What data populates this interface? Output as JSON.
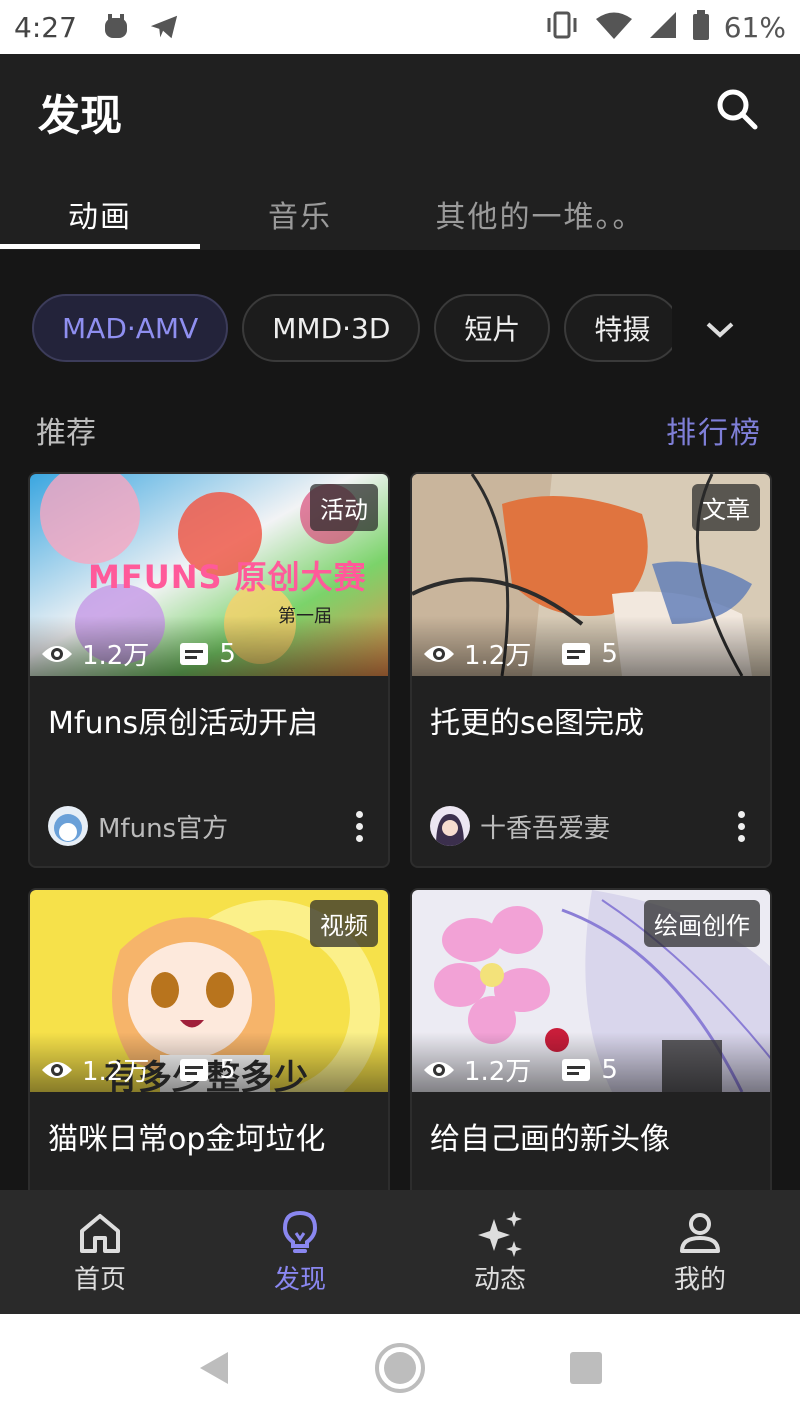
{
  "status_bar": {
    "time": "4:27",
    "battery": "61%",
    "left_icons": [
      "notification-app-icon",
      "telegram-icon"
    ],
    "right_icons": [
      "vibrate-icon",
      "wifi-icon",
      "signal-icon",
      "battery-icon"
    ]
  },
  "header": {
    "title": "发现",
    "search_icon": "search-icon"
  },
  "tabs": [
    {
      "label": "动画",
      "active": true
    },
    {
      "label": "音乐",
      "active": false
    },
    {
      "label": "其他的一堆。。",
      "active": false
    }
  ],
  "chips": [
    {
      "label": "MAD·AMV",
      "selected": true
    },
    {
      "label": "MMD·3D",
      "selected": false
    },
    {
      "label": "短片",
      "selected": false
    },
    {
      "label": "特摄",
      "selected": false
    }
  ],
  "section": {
    "title": "推荐",
    "rank_link": "排行榜"
  },
  "cards": [
    {
      "badge": "活动",
      "views": "1.2万",
      "comments": "5",
      "title": "Mfuns原创活动开启",
      "author": "Mfuns官方",
      "overlay_text": "MFUNS 原创大赛",
      "overlay_sub": "第一届"
    },
    {
      "badge": "文章",
      "views": "1.2万",
      "comments": "5",
      "title": "托更的se图完成",
      "author": "十香吾爱妻"
    },
    {
      "badge": "视频",
      "views": "1.2万",
      "comments": "5",
      "title": "猫咪日常op金坷垃化",
      "author": "",
      "overlay_text": "有多少整多少"
    },
    {
      "badge": "绘画创作",
      "views": "1.2万",
      "comments": "5",
      "title": "给自己画的新头像",
      "author": ""
    }
  ],
  "bottom_nav": [
    {
      "label": "首页",
      "icon": "home-icon",
      "active": false
    },
    {
      "label": "发现",
      "icon": "lightbulb-icon",
      "active": true
    },
    {
      "label": "动态",
      "icon": "sparkles-icon",
      "active": false
    },
    {
      "label": "我的",
      "icon": "person-icon",
      "active": false
    }
  ],
  "colors": {
    "accent": "#8a87f0",
    "background": "#161616",
    "header": "#202020"
  }
}
